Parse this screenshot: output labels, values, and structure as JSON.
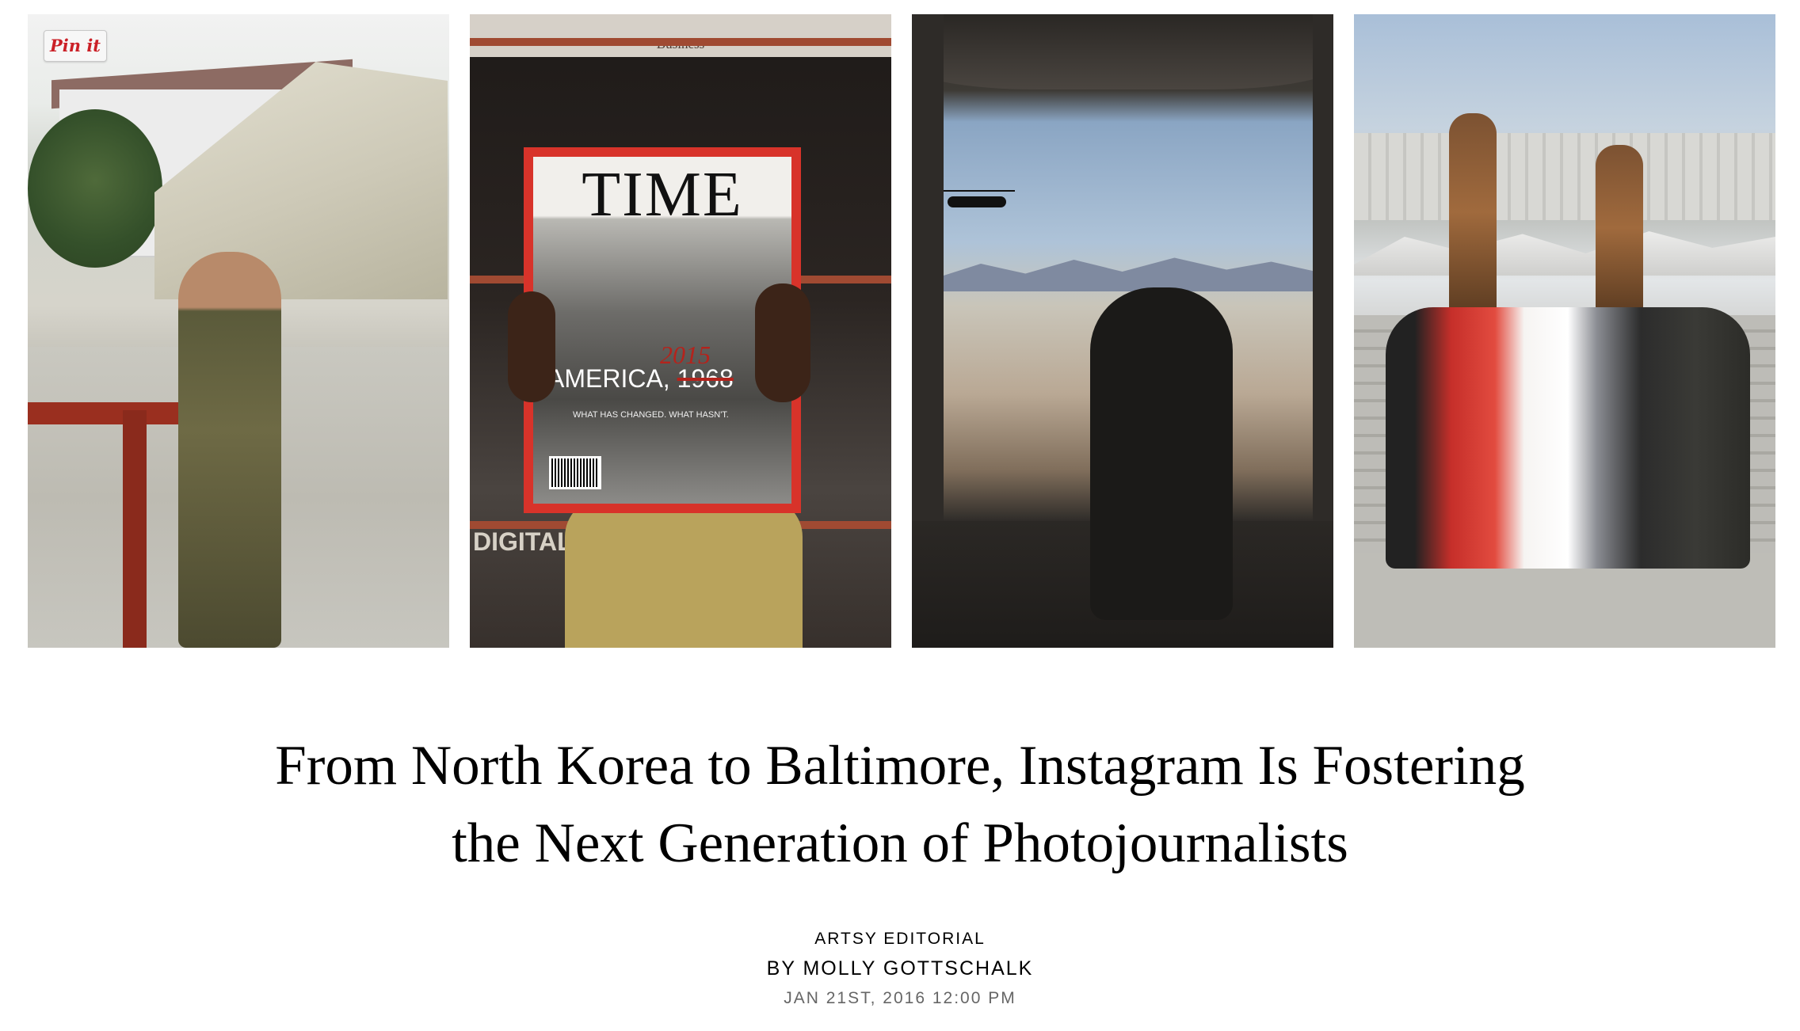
{
  "images": [
    {
      "subject": "Soldier in camouflage making an offering near a tent"
    },
    {
      "subject": "Person holding a TIME magazine cover in front of a newsstand"
    },
    {
      "subject": "Silhouette of a soldier at the open ramp of a helicopter over desert"
    },
    {
      "subject": "Wedding party posing in front of large bronze statues"
    }
  ],
  "pin_button": {
    "label": "Pin it"
  },
  "magazine": {
    "shelf_label": "Business",
    "title": "TIME",
    "year_new": "2015",
    "year_prefix": "AMERICA,",
    "year_old": "1968",
    "subline": "WHAT HAS CHANGED. WHAT HASN'T.",
    "side_text": "DIGITAL PHOTOGRAPHY"
  },
  "article": {
    "headline_line1": "From North Korea to Baltimore, Instagram Is Fostering",
    "headline_line2": "the Next Generation of Photojournalists",
    "source": "ARTSY EDITORIAL",
    "author": "BY MOLLY GOTTSCHALK",
    "date": "JAN 21ST, 2016 12:00 PM"
  },
  "colors": {
    "pin_red": "#cb2027",
    "time_red": "#d8332a",
    "date_gray": "#666666"
  }
}
